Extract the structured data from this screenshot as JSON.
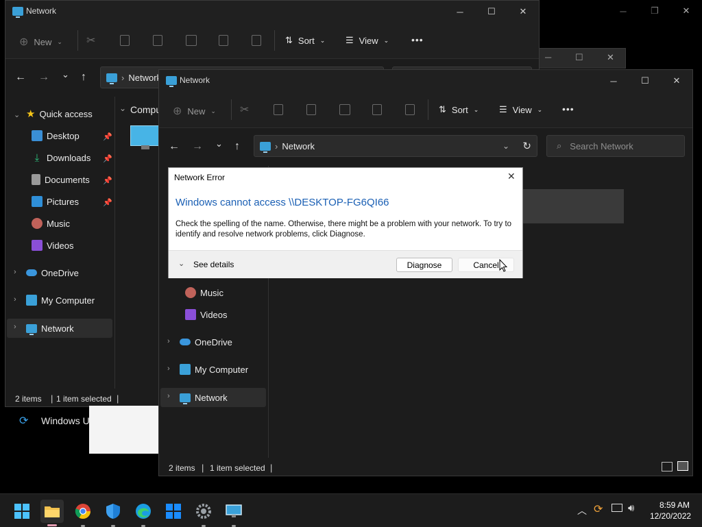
{
  "back_window": {
    "title": "Network",
    "toolbar": {
      "new_label": "New",
      "sort_label": "Sort",
      "view_label": "View",
      "more_label": "•••"
    },
    "address_text": "Network",
    "content_header": "Compu",
    "sidebar": {
      "quick_access": "Quick access",
      "items": [
        {
          "label": "Desktop"
        },
        {
          "label": "Downloads"
        },
        {
          "label": "Documents"
        },
        {
          "label": "Pictures"
        },
        {
          "label": "Music"
        },
        {
          "label": "Videos"
        },
        {
          "label": "OneDrive"
        },
        {
          "label": "My Computer"
        },
        {
          "label": "Network"
        }
      ]
    },
    "status": {
      "items": "2 items",
      "selected": "1 item selected"
    }
  },
  "behind_text": "Windows U",
  "front_window": {
    "title": "Network",
    "toolbar": {
      "new_label": "New",
      "sort_label": "Sort",
      "view_label": "View",
      "more_label": "•••"
    },
    "address_text": "Network",
    "search_placeholder": "Search Network",
    "sidebar": {
      "items": [
        {
          "label": "Music"
        },
        {
          "label": "Videos"
        },
        {
          "label": "OneDrive"
        },
        {
          "label": "My Computer"
        },
        {
          "label": "Network"
        }
      ]
    },
    "status": {
      "items": "2 items",
      "selected": "1 item selected"
    }
  },
  "dialog": {
    "title": "Network Error",
    "heading": "Windows cannot access \\\\DESKTOP-FG6QI66",
    "message": "Check the spelling of the name. Otherwise, there might be a problem with your network. To try to identify and resolve network problems, click Diagnose.",
    "see_details": "See details",
    "diagnose_label": "Diagnose",
    "cancel_label": "Cancel",
    "heading_color": "#1a5fb4"
  },
  "taskbar": {
    "time": "8:59 AM",
    "date": "12/20/2022",
    "apps": [
      "start-icon",
      "file-explorer-icon",
      "chrome-icon",
      "defender-icon",
      "edge-icon",
      "store-icon",
      "settings-icon",
      "network-app-icon"
    ]
  }
}
